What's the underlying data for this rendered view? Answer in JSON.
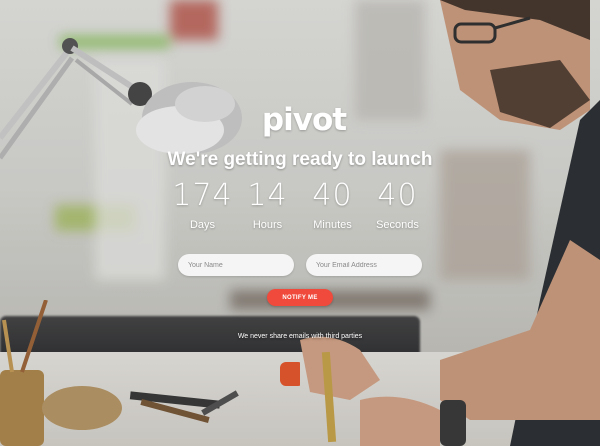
{
  "brand": {
    "logo_text": "pivot"
  },
  "hero": {
    "headline": "We're getting ready to launch"
  },
  "countdown": [
    {
      "value": "174",
      "label": "Days"
    },
    {
      "value": "14",
      "label": "Hours"
    },
    {
      "value": "40",
      "label": "Minutes"
    },
    {
      "value": "40",
      "label": "Seconds"
    }
  ],
  "form": {
    "name_placeholder": "Your Name",
    "email_placeholder": "Your Email Address",
    "submit_label": "NOTIFY ME"
  },
  "privacy_note": "We never share emails with third parties",
  "colors": {
    "accent": "#f04a3c",
    "text": "#ffffff",
    "field_bg": "#f5f5f5"
  }
}
